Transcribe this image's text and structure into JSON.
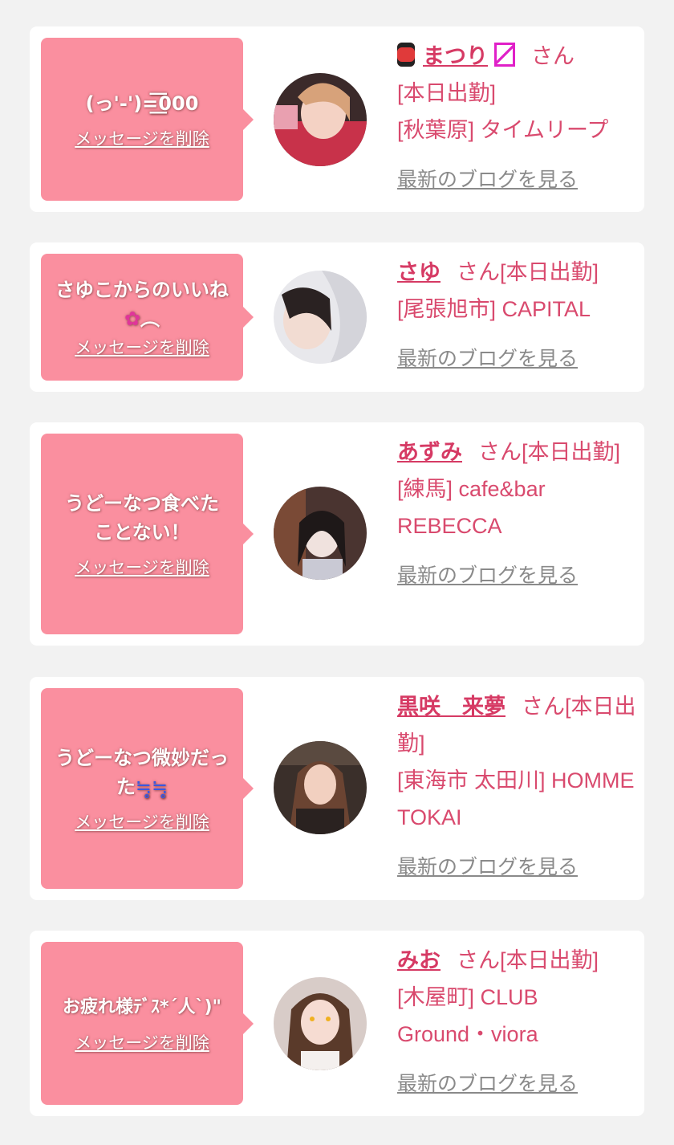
{
  "delete_label": "メッセージを削除",
  "blog_label": "最新のブログを見る",
  "san_label": "さん",
  "colors": {
    "background": "#f2f2f2",
    "card": "#ffffff",
    "bubble": "#fa8f9f",
    "name": "#d63a64",
    "info": "#d94a6e",
    "link_gray": "#8a8a8a"
  },
  "items": [
    {
      "message": "(っ'-')=͟͟͞͞000",
      "name": "まつり",
      "status": "[本日出勤]",
      "place": "[秋葉原] タイムリープ",
      "icon_before": "red-lantern-icon",
      "icon_after": "kimono-icon"
    },
    {
      "message_main": "さゆこからのいいね",
      "message_tail": "︵",
      "message_icon": "bouquet-icon",
      "name": "さゆ",
      "status": "[本日出勤]",
      "place": "[尾張旭市] CAPITAL"
    },
    {
      "message": "うどーなつ食べたことない！",
      "name": "あずみ",
      "status": "[本日出勤]",
      "place": "[練馬] cafe&bar REBECCA"
    },
    {
      "message_main": "うどーなつ微妙だった",
      "message_tail": "≒̥̥̥≒̥̥̥",
      "message_icon": "sweat-face-icon",
      "name": "黒咲　来夢",
      "status": "[本日出勤]",
      "place": "[東海市 太田川] HOMME TOKAI"
    },
    {
      "message": "お疲れ様ﾃﾞｽ*´人`)\"",
      "name": "みお",
      "status": "[本日出勤]",
      "place": "[木屋町] CLUB Ground・viora"
    }
  ]
}
